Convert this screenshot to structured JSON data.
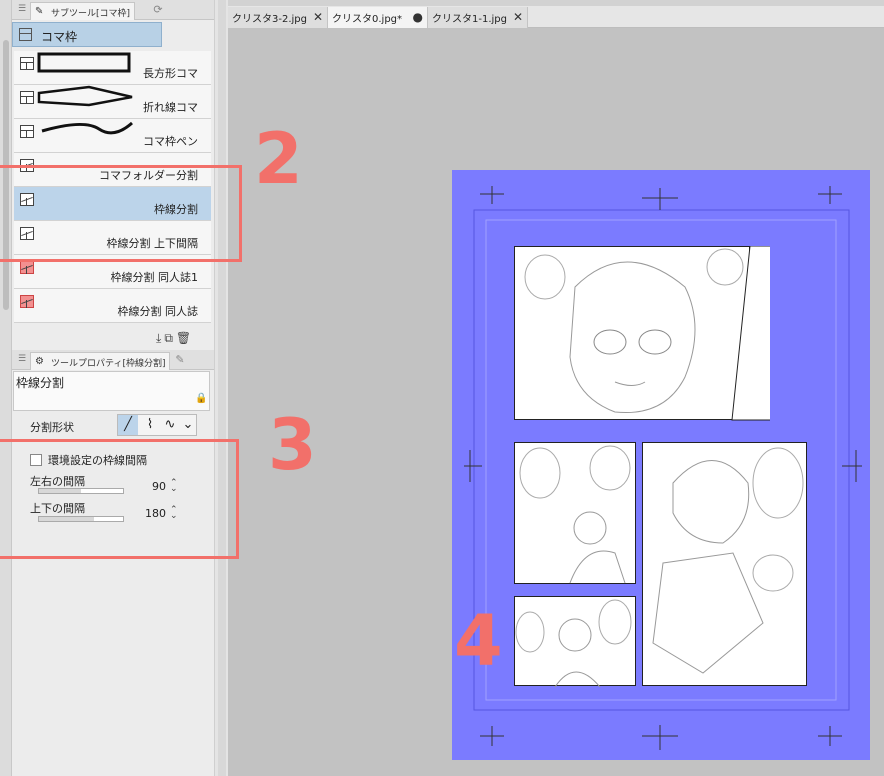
{
  "subtool_panel": {
    "tab_label": "サブツール[コマ枠]",
    "group_title": "コマ枠",
    "items": [
      {
        "label": "長方形コマ",
        "icon": "frame-icon",
        "selected": false
      },
      {
        "label": "折れ線コマ",
        "icon": "frame-icon",
        "selected": false
      },
      {
        "label": "コマ枠ペン",
        "icon": "frame-icon",
        "selected": false
      },
      {
        "label": "コマフォルダー分割",
        "icon": "divide-icon",
        "selected": false
      },
      {
        "label": "枠線分割",
        "icon": "divide-icon",
        "selected": true
      },
      {
        "label": "枠線分割 上下間隔",
        "icon": "divide-icon",
        "selected": false
      },
      {
        "label": "枠線分割 同人誌1",
        "icon": "divide-red-icon",
        "selected": false
      },
      {
        "label": "枠線分割 同人誌",
        "icon": "divide-red-icon",
        "selected": false
      }
    ]
  },
  "tool_property": {
    "tab_label": "ツールプロパティ[枠線分割]",
    "tool_name": "枠線分割",
    "split_shape_label": "分割形状",
    "use_pref_spacing_label": "環境設定の枠線間隔",
    "use_pref_spacing_checked": false,
    "lr_spacing_label": "左右の間隔",
    "lr_spacing_value": "90",
    "tb_spacing_label": "上下の間隔",
    "tb_spacing_value": "180",
    "lr_fraction": 0.5,
    "tb_fraction": 0.65
  },
  "annotations": {
    "n2": "2",
    "n3": "3",
    "n4": "4",
    "color": "#f2706a"
  },
  "doc_tabs": [
    {
      "label": "クリスタ3-2.jpg",
      "active": false,
      "close": "✕"
    },
    {
      "label": "クリスタ0.jpg*",
      "active": true,
      "close": "●"
    },
    {
      "label": "クリスタ1-1.jpg",
      "active": false,
      "close": "✕"
    }
  ],
  "colors": {
    "page_overlay": "#7b7bff",
    "selected_row": "#bcd4ea",
    "canvas_bg": "#c2c2c2"
  }
}
